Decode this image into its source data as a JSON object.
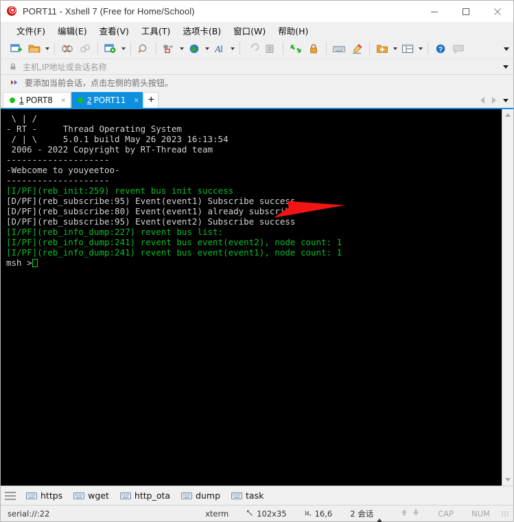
{
  "window": {
    "title": "PORT11 - Xshell 7 (Free for Home/School)",
    "logo_icon": "xshell-logo-icon",
    "minimize_label": "—",
    "maximize_label": "□",
    "close_label": "✕"
  },
  "menubar": {
    "items": [
      {
        "label": "文件(F)",
        "name": "menu-file"
      },
      {
        "label": "编辑(E)",
        "name": "menu-edit"
      },
      {
        "label": "查看(V)",
        "name": "menu-view"
      },
      {
        "label": "工具(T)",
        "name": "menu-tools"
      },
      {
        "label": "选项卡(B)",
        "name": "menu-tabs"
      },
      {
        "label": "窗口(W)",
        "name": "menu-window"
      },
      {
        "label": "帮助(H)",
        "name": "menu-help"
      }
    ]
  },
  "toolbar": {
    "icons": [
      "new-session-icon",
      "open-folder-icon",
      "disconnect-icon",
      "link-icon",
      "session-properties-icon",
      "find-icon",
      "transfer-icon",
      "globe-icon",
      "font-icon",
      "undo-icon",
      "copy-icon",
      "fullscreen-icon",
      "lock-icon",
      "keyboard-icon",
      "highlight-icon",
      "add-folder-icon",
      "layout-icon",
      "help-icon",
      "comment-icon"
    ],
    "overflow_icon": "chevron-down-icon"
  },
  "address_bar": {
    "lock_icon": "lock-icon",
    "placeholder": "主机,IP地址或会话名称",
    "value": "",
    "dropdown_icon": "chevron-down-icon"
  },
  "hint_bar": {
    "icon": "red-arrow-icon",
    "text": "要添加当前会话，点击左侧的箭头按钮。"
  },
  "tabs": {
    "items": [
      {
        "num": "1",
        "label": "PORT8",
        "active": false,
        "status_color": "#19c219",
        "close_label": "×"
      },
      {
        "num": "2",
        "label": "PORT11",
        "active": true,
        "status_color": "#19c219",
        "close_label": "×"
      }
    ],
    "add_label": "+",
    "nav_prev_icon": "chevron-left-icon",
    "nav_next_icon": "chevron-right-icon",
    "nav_list_icon": "chevron-down-icon",
    "active_color": "#0b8fde"
  },
  "terminal": {
    "background": "#000000",
    "foreground": "#d4d4d4",
    "info_color": "#0bbd28",
    "cursor_color": "#19d919",
    "lines": [
      {
        "text": " \\ | /",
        "color": "white"
      },
      {
        "text": "- RT -     Thread Operating System",
        "color": "white"
      },
      {
        "text": " / | \\     5.0.1 build May 26 2023 16:13:54",
        "color": "white"
      },
      {
        "text": " 2006 - 2022 Copyright by RT-Thread team",
        "color": "white"
      },
      {
        "text": "--------------------",
        "color": "white"
      },
      {
        "text": "-Webcome to youyeetoo-",
        "color": "white"
      },
      {
        "text": "--------------------",
        "color": "white"
      },
      {
        "text": "[I/PF](reb_init:259) revent bus init success",
        "color": "green"
      },
      {
        "text": "[D/PF](reb_subscribe:95) Event(event1) Subscribe success",
        "color": "white"
      },
      {
        "text": "[D/PF](reb_subscribe:80) Event(event1) already subscribe",
        "color": "white"
      },
      {
        "text": "[D/PF](reb_subscribe:95) Event(event2) Subscribe success",
        "color": "white"
      },
      {
        "text": "[I/PF](reb_info_dump:227) revent bus list:",
        "color": "green"
      },
      {
        "text": "[I/PF](reb_info_dump:241) revent bus event(event2), node count: 1",
        "color": "green"
      },
      {
        "text": "[I/PF](reb_info_dump:241) revent bus event(event1), node count: 1",
        "color": "green"
      }
    ],
    "prompt": "msh >",
    "annotation": {
      "type": "arrow",
      "color": "#f01414",
      "points_to": "already subscribe"
    },
    "scroll_up_icon": "chevron-up-icon",
    "scroll_down_icon": "chevron-down-icon"
  },
  "quick_commands": {
    "handle_icon": "drag-handle-icon",
    "items": [
      {
        "label": "https",
        "icon": "keyboard-icon"
      },
      {
        "label": "wget",
        "icon": "keyboard-icon"
      },
      {
        "label": "http_ota",
        "icon": "keyboard-icon"
      },
      {
        "label": "dump",
        "icon": "keyboard-icon"
      },
      {
        "label": "task",
        "icon": "keyboard-icon"
      }
    ]
  },
  "status_bar": {
    "connection": "serial://:22",
    "emulation": "xterm",
    "size_icon": "resize-icon",
    "size": "102x35",
    "cursor_icon": "cursor-pos-icon",
    "cursor_pos": "16,6",
    "sessions": "2 会话",
    "sessions_caret_icon": "chevron-up-icon",
    "upload_icon": "arrow-up-icon",
    "download_icon": "arrow-down-icon",
    "cap": "CAP",
    "num": "NUM"
  }
}
